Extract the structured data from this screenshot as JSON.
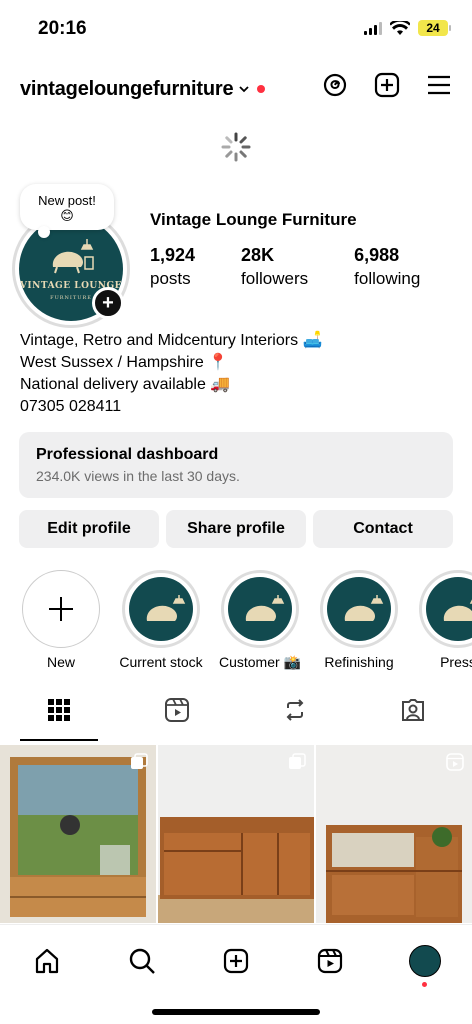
{
  "status": {
    "time": "20:16",
    "battery": "24"
  },
  "header": {
    "username": "vintageloungefurniture"
  },
  "profile": {
    "note": "New post!",
    "note_emoji": "😊",
    "avatar_title": "VINTAGE LOUNGE",
    "avatar_sub": "FURNITURE",
    "display_name": "Vintage Lounge Furniture",
    "stats": [
      {
        "num": "1,924",
        "label": "posts"
      },
      {
        "num": "28K",
        "label": "followers"
      },
      {
        "num": "6,988",
        "label": "following"
      }
    ],
    "bio": [
      "Vintage, Retro and Midcentury Interiors 🛋️",
      "West Sussex / Hampshire 📍",
      "National delivery available 🚚",
      "07305 028411"
    ]
  },
  "dashboard": {
    "title": "Professional dashboard",
    "subtitle": "234.0K views in the last 30 days."
  },
  "buttons": {
    "edit": "Edit profile",
    "share": "Share profile",
    "contact": "Contact"
  },
  "highlights": [
    {
      "label": "New"
    },
    {
      "label": "Current stock"
    },
    {
      "label": "Customer 📸"
    },
    {
      "label": "Refinishing"
    },
    {
      "label": "Press"
    }
  ],
  "colors": {
    "brand_teal": "#124a4f",
    "notification_red": "#ff3040",
    "button_gray": "#efeff0"
  }
}
